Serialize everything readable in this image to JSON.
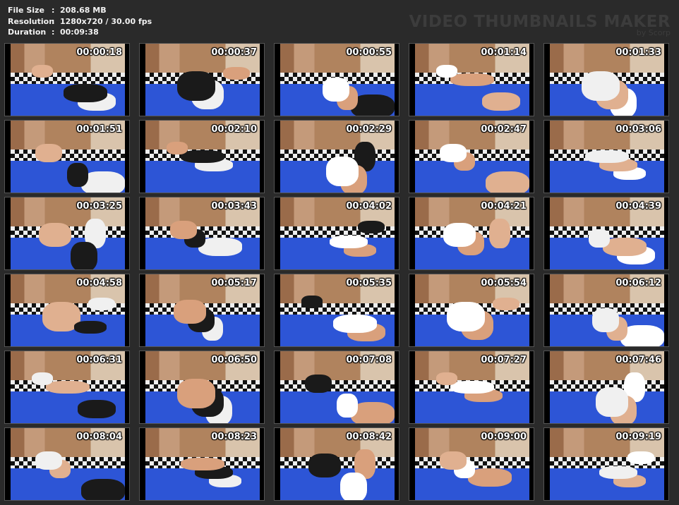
{
  "meta": {
    "file_size_label": "File Size",
    "file_size_value": "208.68 MB",
    "resolution_label": "Resolution",
    "resolution_value": "1280x720 / 30.00 fps",
    "duration_label": "Duration",
    "duration_value": "00:09:38",
    "separator": ":"
  },
  "brand": {
    "title": "VIDEO THUMBNAILS MAKER",
    "subtitle": "by Scorp"
  },
  "thumbnails": [
    "00:00:18",
    "00:00:37",
    "00:00:55",
    "00:01:14",
    "00:01:33",
    "00:01:51",
    "00:02:10",
    "00:02:29",
    "00:02:47",
    "00:03:06",
    "00:03:25",
    "00:03:43",
    "00:04:02",
    "00:04:21",
    "00:04:39",
    "00:04:58",
    "00:05:17",
    "00:05:35",
    "00:05:54",
    "00:06:12",
    "00:06:31",
    "00:06:50",
    "00:07:08",
    "00:07:27",
    "00:07:46",
    "00:08:04",
    "00:08:23",
    "00:08:42",
    "00:09:00",
    "00:09:19"
  ],
  "colors": {
    "background": "#2a2a2a",
    "mat": "#2d55d6",
    "text": "#ffffff"
  }
}
